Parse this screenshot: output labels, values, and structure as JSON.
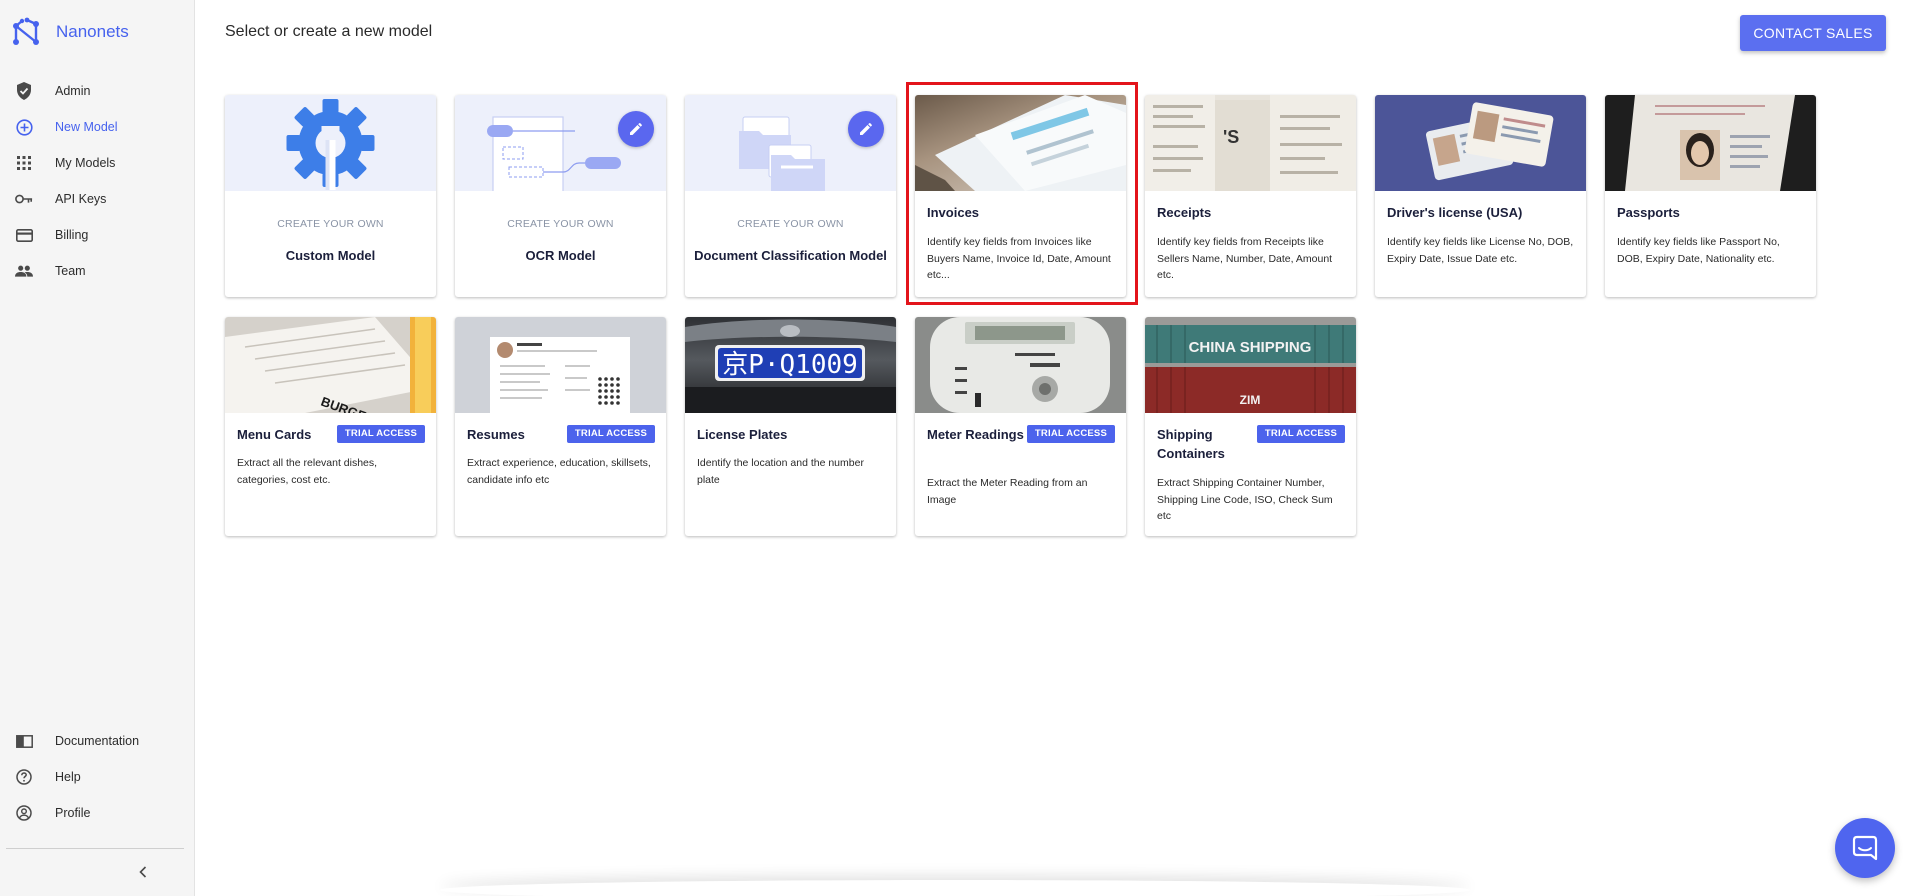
{
  "brand": {
    "name": "Nanonets",
    "logo_icon": "nanonets-logo-icon",
    "accent": "#4662ee"
  },
  "sidebar": {
    "items": [
      {
        "label": "Admin",
        "icon": "shield-check-icon"
      },
      {
        "label": "New Model",
        "icon": "add-circle-icon",
        "active": true
      },
      {
        "label": "My Models",
        "icon": "grid-icon"
      },
      {
        "label": "API Keys",
        "icon": "key-icon"
      },
      {
        "label": "Billing",
        "icon": "credit-card-icon"
      },
      {
        "label": "Team",
        "icon": "people-icon"
      }
    ],
    "bottom_items": [
      {
        "label": "Documentation",
        "icon": "book-icon"
      },
      {
        "label": "Help",
        "icon": "help-circle-icon"
      },
      {
        "label": "Profile",
        "icon": "account-circle-icon"
      }
    ],
    "collapse_icon": "chevron-left-icon"
  },
  "header": {
    "title": "Select or create a new model",
    "contact_label": "CONTACT SALES"
  },
  "create_cards": [
    {
      "subtitle": "CREATE YOUR OWN",
      "title": "Custom Model"
    },
    {
      "subtitle": "CREATE YOUR OWN",
      "title": "OCR Model"
    },
    {
      "subtitle": "CREATE YOUR OWN",
      "title": "Document Classification Model"
    }
  ],
  "row1_models": [
    {
      "title": "Invoices",
      "desc": "Identify key fields from Invoices like Buyers Name, Invoice Id, Date, Amount etc...",
      "selected": true
    },
    {
      "title": "Receipts",
      "desc": "Identify key fields from Receipts like Sellers Name, Number, Date, Amount etc."
    },
    {
      "title": "Driver's license (USA)",
      "desc": "Identify key fields like License No, DOB, Expiry Date, Issue Date etc."
    },
    {
      "title": "Passports",
      "desc": "Identify key fields like Passport No, DOB, Expiry Date, Nationality etc."
    }
  ],
  "row2_models": [
    {
      "title": "Menu Cards",
      "desc": "Extract all the relevant dishes, categories, cost etc.",
      "badge": "TRIAL ACCESS"
    },
    {
      "title": "Resumes",
      "desc": "Extract experience, education, skillsets, candidate info etc",
      "badge": "TRIAL ACCESS"
    },
    {
      "title": "License Plates",
      "desc": "Identify the location and the number plate",
      "plate_text": "京P·Q1009"
    },
    {
      "title": "Meter Readings",
      "desc": "Extract the Meter Reading from an Image",
      "badge": "TRIAL ACCESS"
    },
    {
      "title": "Shipping Containers",
      "desc": "Extract Shipping Container Number, Shipping Line Code, ISO, Check Sum etc",
      "badge": "TRIAL ACCESS",
      "container_text": "CHINA SHIPPING",
      "container_text2": "ZIM"
    }
  ],
  "chat": {
    "icon": "chat-icon"
  }
}
